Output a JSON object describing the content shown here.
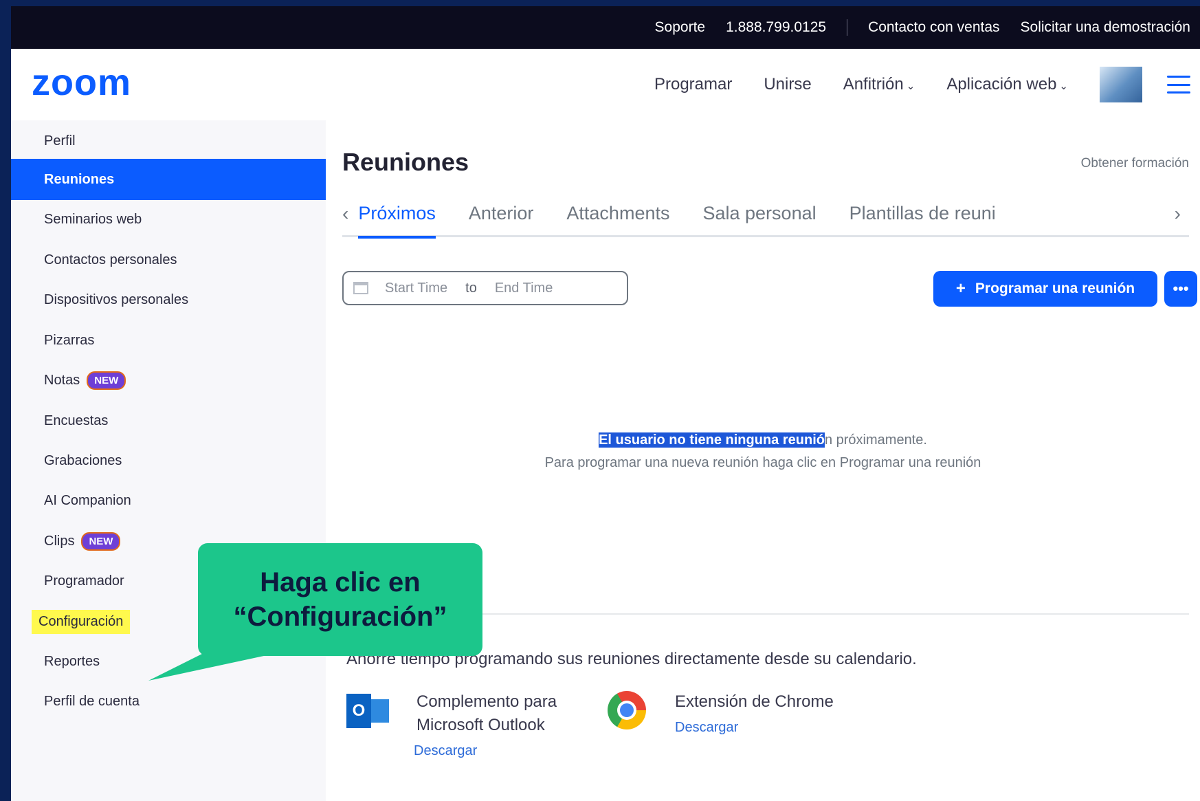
{
  "utility_bar": {
    "support": "Soporte",
    "phone": "1.888.799.0125",
    "contact_sales": "Contacto con ventas",
    "request_demo": "Solicitar una demostración"
  },
  "header": {
    "logo": "zoom",
    "nav": {
      "schedule": "Programar",
      "join": "Unirse",
      "host": "Anfitrión",
      "web_app": "Aplicación web"
    }
  },
  "sidebar": {
    "items": [
      {
        "label": "Perfil"
      },
      {
        "label": "Reuniones"
      },
      {
        "label": "Seminarios web"
      },
      {
        "label": "Contactos personales"
      },
      {
        "label": "Dispositivos personales"
      },
      {
        "label": "Pizarras"
      },
      {
        "label": "Notas",
        "badge": "NEW"
      },
      {
        "label": "Encuestas"
      },
      {
        "label": "Grabaciones"
      },
      {
        "label": "AI Companion"
      },
      {
        "label": "Clips",
        "badge": "NEW"
      },
      {
        "label": "Programador"
      },
      {
        "label": "Configuración"
      },
      {
        "label": "Reportes"
      },
      {
        "label": "Perfil de cuenta"
      }
    ],
    "active_index": 1,
    "highlight_index": 12
  },
  "main": {
    "title": "Reuniones",
    "training_link": "Obtener formación",
    "tabs": [
      {
        "label": "Próximos"
      },
      {
        "label": "Anterior"
      },
      {
        "label": "Attachments"
      },
      {
        "label": "Sala personal"
      },
      {
        "label": "Plantillas de reuni"
      }
    ],
    "date_range": {
      "start_placeholder": "Start Time",
      "to": "to",
      "end_placeholder": "End Time"
    },
    "schedule_button": "Programar una reunión",
    "more_button": "•••",
    "empty_state": {
      "line1_selected": "El usuario no tiene ninguna reunió",
      "line1_rest": "n próximamente.",
      "line2": "Para programar una nueva reunión haga clic en Programar una reunión"
    },
    "save_time_text": "Ahorre tiempo programando sus reuniones directamente desde su calendario.",
    "addons": {
      "outlook": {
        "title_line1": "Complemento para",
        "title_line2": "Microsoft Outlook",
        "download": "Descargar"
      },
      "chrome": {
        "title": "Extensión de Chrome",
        "download": "Descargar"
      }
    }
  },
  "callout": {
    "line1": "Haga clic en",
    "line2": "“Configuración”"
  },
  "colors": {
    "background": "#0b2257",
    "zoom_blue": "#0b5cff",
    "callout_green": "#1cc68b",
    "highlight_yellow": "#fff94d"
  }
}
